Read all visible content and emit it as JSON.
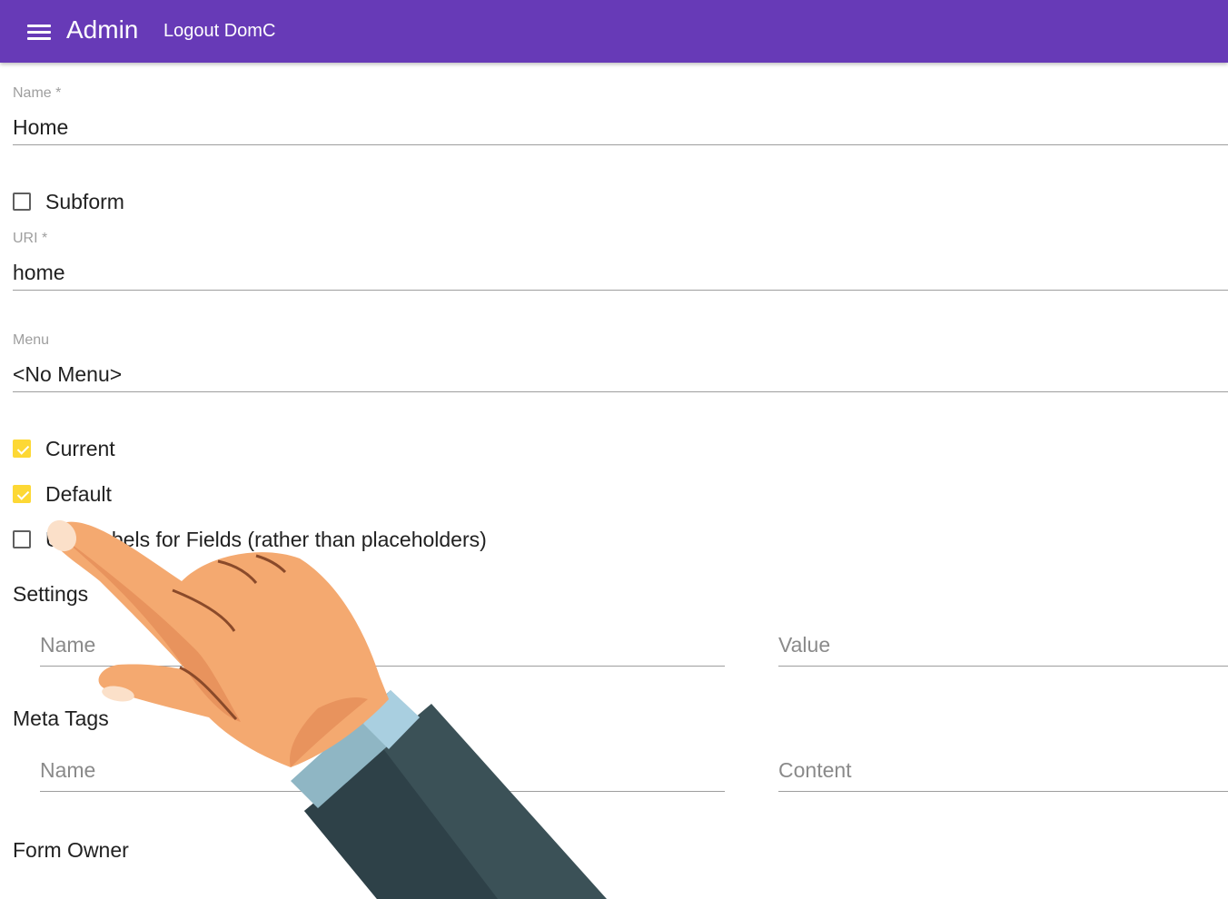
{
  "header": {
    "title": "Admin",
    "logout_label": "Logout DomC",
    "menu_icon": "hamburger-menu-icon",
    "background": "#673ab7"
  },
  "form": {
    "name": {
      "label": "Name *",
      "value": "Home"
    },
    "subform": {
      "label": "Subform",
      "checked": false
    },
    "uri": {
      "label": "URI *",
      "value": "home"
    },
    "menu": {
      "label": "Menu",
      "value": "<No Menu>"
    },
    "current": {
      "label": "Current",
      "checked": true
    },
    "default": {
      "label": "Default",
      "checked": true
    },
    "labels_for_fields": {
      "label": "Use Labels for Fields (rather than placeholders)",
      "checked": false
    }
  },
  "settings": {
    "title": "Settings",
    "name_placeholder": "Name",
    "value_placeholder": "Value"
  },
  "meta_tags": {
    "title": "Meta Tags",
    "name_placeholder": "Name",
    "content_placeholder": "Content"
  },
  "form_owner": {
    "title": "Form Owner"
  },
  "colors": {
    "accent": "#fdd835",
    "appbar": "#673ab7"
  }
}
